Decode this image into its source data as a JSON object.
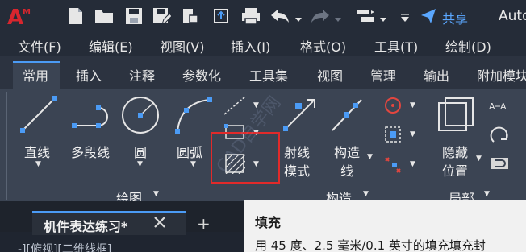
{
  "quick_access": {
    "share_label": "共享",
    "app_title": "Auto"
  },
  "menu": {
    "items": [
      "文件(F)",
      "编辑(E)",
      "视图(V)",
      "插入(I)",
      "格式(O)",
      "工具(T)",
      "绘制(D)"
    ]
  },
  "ribbon": {
    "tabs": [
      "常用",
      "插入",
      "注释",
      "参数化",
      "工具集",
      "视图",
      "管理",
      "输出",
      "附加模块"
    ],
    "active_tab": "常用",
    "draw_panel": {
      "line": "直线",
      "polyline": "多段线",
      "circle": "圆",
      "arc": "圆弧",
      "panel_title": "绘图"
    },
    "construct_panel": {
      "ray_line1": "射线",
      "ray_line2": "模式",
      "xline_line1": "构造",
      "xline_line2": "线",
      "panel_title": "构造"
    },
    "local_panel": {
      "hide_line1": "隐藏",
      "hide_line2": "位置",
      "panel_title": "局部"
    }
  },
  "document": {
    "tab_name": "机件表达练习*",
    "add_tab": "+",
    "viewport_label": "-][俯视][二维线框]"
  },
  "tooltip": {
    "title": "填充",
    "description": "用 45 度、2.5 毫米/0.1 英寸的填充填充封"
  },
  "watermark": "CAD自学网",
  "colors": {
    "accent": "#4b9bf5",
    "highlight_box": "#e12a2a",
    "logo_red": "#d7262e",
    "panel_bg": "#3b4453",
    "tooltip_bg": "#f1f1f1"
  }
}
